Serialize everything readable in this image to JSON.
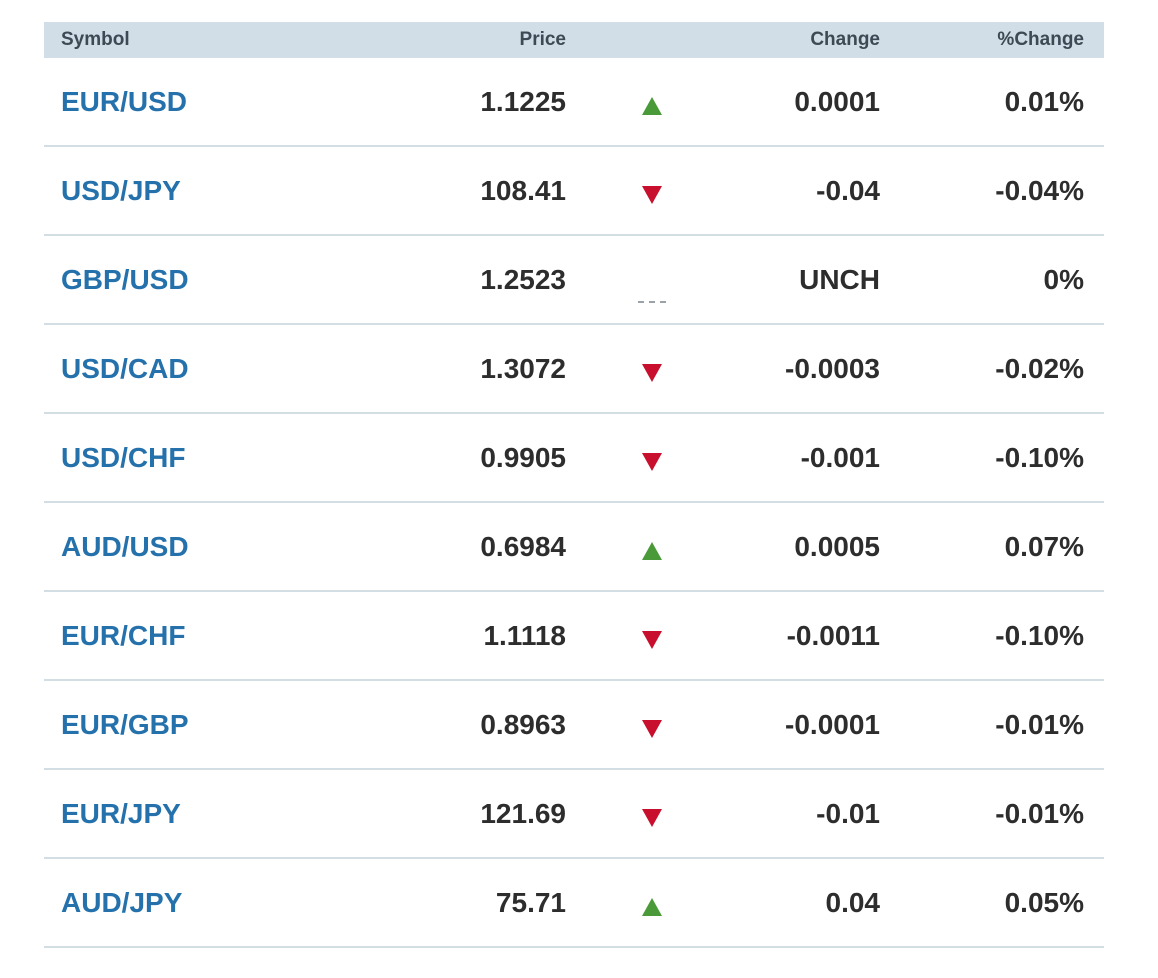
{
  "table": {
    "headers": {
      "symbol": "Symbol",
      "price": "Price",
      "indicator": "",
      "change": "Change",
      "pct_change": "%Change"
    },
    "rows": [
      {
        "symbol": "EUR/USD",
        "price": "1.1225",
        "direction": "up",
        "change": "0.0001",
        "pct_change": "0.01%"
      },
      {
        "symbol": "USD/JPY",
        "price": "108.41",
        "direction": "down",
        "change": "-0.04",
        "pct_change": "-0.04%"
      },
      {
        "symbol": "GBP/USD",
        "price": "1.2523",
        "direction": "unchanged",
        "change": "UNCH",
        "pct_change": "0%"
      },
      {
        "symbol": "USD/CAD",
        "price": "1.3072",
        "direction": "down",
        "change": "-0.0003",
        "pct_change": "-0.02%"
      },
      {
        "symbol": "USD/CHF",
        "price": "0.9905",
        "direction": "down",
        "change": "-0.001",
        "pct_change": "-0.10%"
      },
      {
        "symbol": "AUD/USD",
        "price": "0.6984",
        "direction": "up",
        "change": "0.0005",
        "pct_change": "0.07%"
      },
      {
        "symbol": "EUR/CHF",
        "price": "1.1118",
        "direction": "down",
        "change": "-0.0011",
        "pct_change": "-0.10%"
      },
      {
        "symbol": "EUR/GBP",
        "price": "0.8963",
        "direction": "down",
        "change": "-0.0001",
        "pct_change": "-0.01%"
      },
      {
        "symbol": "EUR/JPY",
        "price": "121.69",
        "direction": "down",
        "change": "-0.01",
        "pct_change": "-0.01%"
      },
      {
        "symbol": "AUD/JPY",
        "price": "75.71",
        "direction": "up",
        "change": "0.04",
        "pct_change": "0.05%"
      }
    ]
  },
  "icons": {
    "up": "up-triangle-icon",
    "down": "down-triangle-icon",
    "unchanged": "unchanged-dash-icon"
  },
  "colors": {
    "header_bg": "#d1dee7",
    "symbol_link": "#2471ab",
    "up": "#4a9a3a",
    "down": "#c8102e",
    "unchanged": "#9aa3aa",
    "row_divider": "#d3dde4"
  }
}
